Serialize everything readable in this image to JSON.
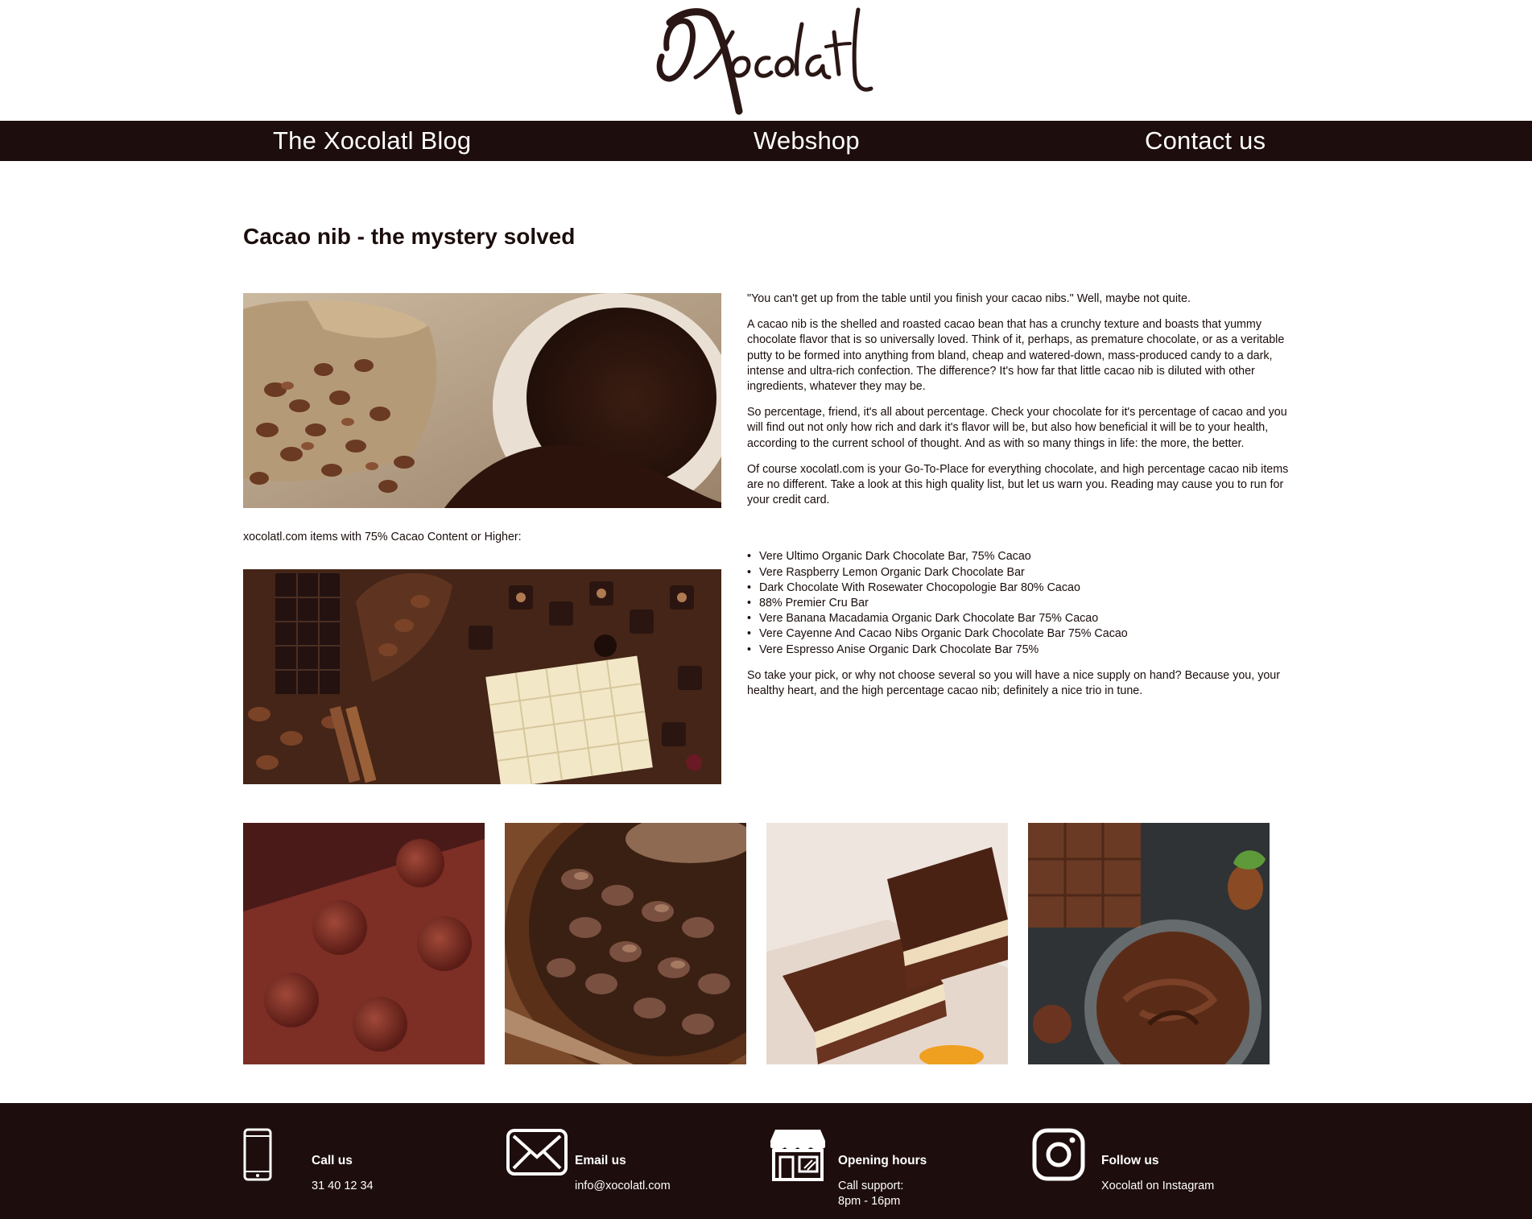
{
  "brand": {
    "logo_text": "Xocolatl"
  },
  "nav": {
    "items": [
      {
        "label": "The Xocolatl Blog"
      },
      {
        "label": "Webshop"
      },
      {
        "label": "Contact us"
      }
    ]
  },
  "article": {
    "title": "Cacao nib - the mystery solved",
    "paragraphs": [
      "\"You can't get up from the table until you finish your cacao nibs.\" Well, maybe not quite.",
      "A cacao nib is the shelled and roasted cacao bean that has a crunchy texture and boasts that yummy chocolate flavor that is so universally loved. Think of it, perhaps, as premature chocolate, or as a veritable putty to be formed into anything from bland, cheap and watered-down, mass-produced candy to a dark, intense and ultra-rich confection. The difference? It's how far that little cacao nib is diluted with other ingredients, whatever they may be.",
      "So percentage, friend, it's all about percentage. Check your chocolate for it's percentage of cacao and you will find out not only how rich and dark it's flavor will be, but also how beneficial it will be to your health, according to the current school of thought. And as with so many things in life: the more, the better.",
      "Of course xocolatl.com is your Go-To-Place for everything chocolate, and high percentage cacao nib items are no different. Take a look at this high quality list, but let us warn you. Reading may cause you to run for your credit card."
    ],
    "list_caption": "xocolatl.com items with 75% Cacao Content or Higher:",
    "products": [
      "Vere Ultimo Organic Dark Chocolate Bar, 75% Cacao",
      "Vere Raspberry Lemon Organic Dark Chocolate Bar",
      "Dark Chocolate With Rosewater Chocopologie Bar 80% Cacao",
      "88% Premier Cru Bar",
      "Vere Banana Macadamia Organic Dark Chocolate Bar 75% Cacao",
      "Vere Cayenne And Cacao Nibs Organic Dark Chocolate Bar 75% Cacao",
      "Vere Espresso Anise Organic Dark Chocolate Bar 75%"
    ],
    "closing": "So take your pick, or why not choose several so you will have a nice supply on hand? Because you, your healthy heart, and the high percentage cacao nib; definitely a nice trio in tune."
  },
  "footer": {
    "call": {
      "heading": "Call us",
      "value": "31 40 12 34",
      "icon": "phone-icon"
    },
    "email": {
      "heading": "Email us",
      "value": "info@xocolatl.com",
      "icon": "envelope-icon"
    },
    "hours": {
      "heading": "Opening hours",
      "line1": "Call support:",
      "line2": "8pm - 16pm",
      "icon": "shop-icon"
    },
    "follow": {
      "heading": "Follow us",
      "value": "Xocolatl on Instagram",
      "icon": "instagram-icon"
    }
  },
  "colors": {
    "dark_brown": "#1d0d0c",
    "text": "#1a0d0b",
    "background": "#ffffff"
  }
}
